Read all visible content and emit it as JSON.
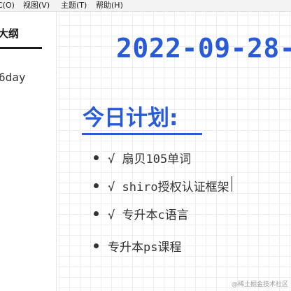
{
  "menubar": {
    "items": [
      {
        "label": "C(O)"
      },
      {
        "label": "视图(V)"
      },
      {
        "label": "主题(T)"
      },
      {
        "label": "帮助(H)"
      }
    ]
  },
  "sidebar": {
    "title": "大纲",
    "items": [
      {
        "label": "6day"
      }
    ]
  },
  "document": {
    "date_heading": "2022-09-28-",
    "plan_heading": "今日计划:",
    "tasks": [
      {
        "text": "√ 扇贝105单词",
        "done": true
      },
      {
        "text": "√ shiro授权认证框架",
        "done": true
      },
      {
        "text": "√ 专升本c语言",
        "done": true
      },
      {
        "text": "专升本ps课程",
        "done": false
      }
    ]
  },
  "watermark": "@稀土掘金技术社区",
  "colors": {
    "accent": "#2a5bd7",
    "text": "#333333",
    "grid": "#eeeeee"
  }
}
